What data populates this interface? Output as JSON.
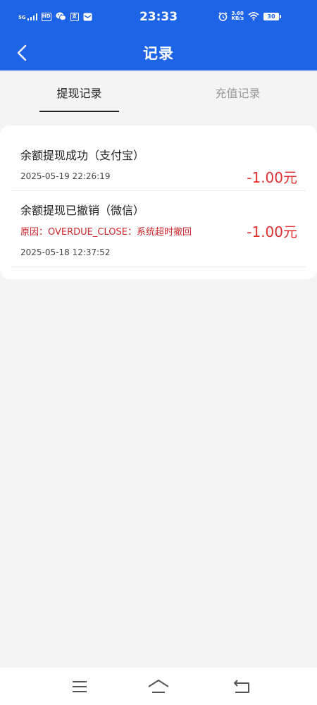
{
  "status_bar": {
    "network": "5G",
    "hd": "HD",
    "time": "23:33",
    "net_speed_value": "3.60",
    "net_speed_unit": "KB/s",
    "battery": "30"
  },
  "nav": {
    "title": "记录"
  },
  "tabs": [
    {
      "label": "提现记录",
      "active": true
    },
    {
      "label": "充值记录",
      "active": false
    }
  ],
  "records": [
    {
      "title": "余额提现成功（支付宝）",
      "time": "2025-05-19 22:26:19",
      "amount": "-1.00元"
    },
    {
      "title": "余额提现已撤销（微信）",
      "reason": "原因：OVERDUE_CLOSE：系统超时撤回",
      "time": "2025-05-18 12:37:52",
      "amount": "-1.00元"
    }
  ],
  "colors": {
    "header_bg": "#1e64e6",
    "amount": "#e03030",
    "reason": "#d0262b"
  },
  "icons": {
    "back": "chevron-left-icon",
    "menu": "menu-icon",
    "home": "home-icon",
    "return": "back-arrow-icon"
  }
}
